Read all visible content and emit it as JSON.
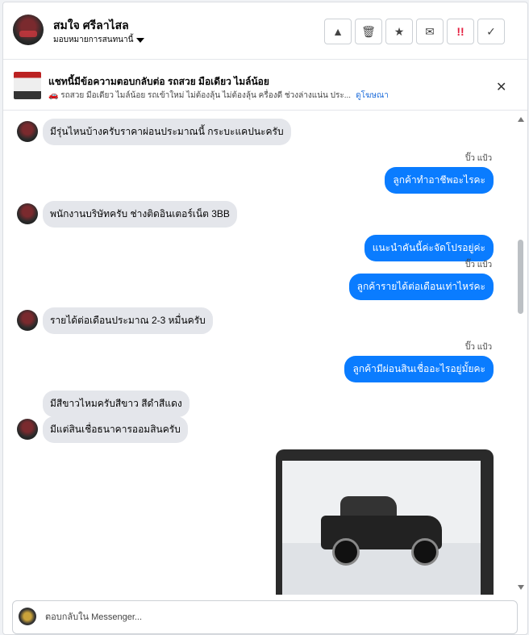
{
  "header": {
    "contact_name": "สมใจ ศรีลาไสล",
    "assign_label": "มอบหมายการสนทนานี้",
    "actions": [
      {
        "name": "warning-icon",
        "glyph": "▲"
      },
      {
        "name": "trash-icon",
        "glyph": "🗑"
      },
      {
        "name": "star-icon",
        "glyph": "★"
      },
      {
        "name": "mail-icon",
        "glyph": "✉"
      },
      {
        "name": "follow-up-icon",
        "glyph": "!!"
      },
      {
        "name": "check-icon",
        "glyph": "✓"
      }
    ]
  },
  "ad_banner": {
    "title": "แชทนี้มีข้อความตอบกลับต่อ รถสวย มือเดียว ไมล์น้อย",
    "subtitle": "🚗 รถสวย มือเดียว ไมล์น้อย รถเข้าใหม่ ไม่ต้องลุ้น ไม่ต้องลุ้น ครื่องดี ช่วงล่างแน่น ประ...",
    "link": "ดูโฆษณา"
  },
  "messages": [
    {
      "dir": "in",
      "text": "มีรุ่นไหนบ้างครับราคาผ่อนประมาณนี้ กระบะแคปนะครับ"
    },
    {
      "dir": "out",
      "sender": "ปิ๊ว แป้ว",
      "text": "ลูกค้าทำอาชีพอะไรคะ"
    },
    {
      "dir": "in",
      "text": "พนักงานบริษัทครับ ช่างติดอินเตอร์เน็ต 3BB"
    },
    {
      "dir": "out",
      "text": "แนะนำคันนี้ค่ะจัดโปรอยู่ค่ะ"
    },
    {
      "dir": "out",
      "sender": "ปิ๊ว แป้ว",
      "text": "ลูกค้ารายได้ต่อเดือนเท่าไหร่คะ"
    },
    {
      "dir": "in",
      "text": "รายได้ต่อเดือนประมาณ 2-3 หมื่นครับ"
    },
    {
      "dir": "out",
      "sender": "ปิ๊ว แป้ว",
      "text": "ลูกค้ามีผ่อนสินเชื่ออะไรอยู่มั้ยคะ"
    },
    {
      "dir": "in",
      "text": "มีสีขาวไหมครับสีขาว สีดำสีแดง"
    },
    {
      "dir": "in",
      "text": "มีแต่สินเชื่อธนาคารออมสินครับ"
    }
  ],
  "composer": {
    "placeholder": "ตอบกลับใน Messenger..."
  },
  "colors": {
    "accent": "#0a7cff",
    "incoming_bubble": "#e4e6eb",
    "link": "#216fdb"
  }
}
